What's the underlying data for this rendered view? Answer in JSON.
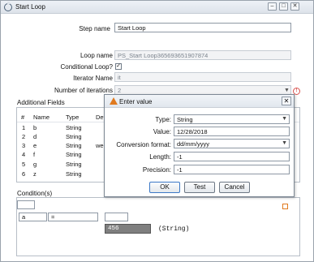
{
  "window": {
    "title": "Start Loop"
  },
  "form": {
    "step_name_label": "Step name",
    "step_name_value": "Start Loop",
    "loop_name_label": "Loop name",
    "loop_name_value": "PS_Start Loop365693651907874",
    "conditional_label": "Conditional Loop?",
    "conditional_checked": "✓",
    "iterator_label": "Iterator Name",
    "iterator_value": "it",
    "iterations_label": "Number of iterations",
    "iterations_value": "2"
  },
  "additional_fields": {
    "title": "Additional Fields",
    "columns": [
      "#",
      "Name",
      "Type",
      "Def"
    ],
    "rows": [
      {
        "num": "1",
        "name": "b",
        "type": "String",
        "def": ""
      },
      {
        "num": "2",
        "name": "d",
        "type": "String",
        "def": ""
      },
      {
        "num": "3",
        "name": "e",
        "type": "String",
        "def": "wee"
      },
      {
        "num": "4",
        "name": "f",
        "type": "String",
        "def": ""
      },
      {
        "num": "5",
        "name": "g",
        "type": "String",
        "def": ""
      },
      {
        "num": "6",
        "name": "z",
        "type": "String",
        "def": ""
      }
    ]
  },
  "conditions": {
    "title": "Condition(s)",
    "left_value": "a",
    "operator": "=",
    "right_value": "",
    "constant_value": "456",
    "constant_type": "(String)"
  },
  "dialog": {
    "title": "Enter value",
    "type_label": "Type:",
    "type_value": "String",
    "value_label": "Value:",
    "value_value": "12/28/2018",
    "format_label": "Conversion format:",
    "format_value": "dd/mm/yyyy",
    "length_label": "Length:",
    "length_value": "-1",
    "precision_label": "Precision:",
    "precision_value": "-1",
    "ok_label": "OK",
    "test_label": "Test",
    "cancel_label": "Cancel"
  },
  "colors": {
    "warning": "#d9534f",
    "accent": "#e07a1f",
    "constant_bg": "#7f7f7f"
  }
}
